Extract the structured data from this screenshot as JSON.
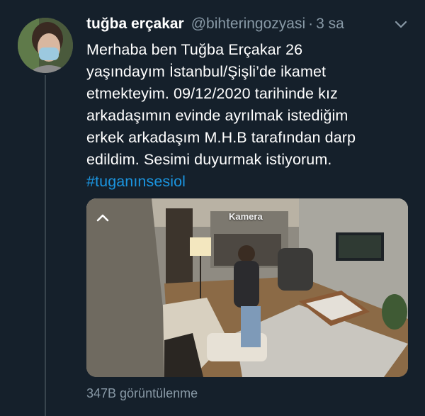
{
  "tweet": {
    "display_name": "tuğba erçakar",
    "handle": "@bihteringozyasi",
    "separator": "·",
    "timestamp": "3 sa",
    "text_lines": [
      "Merhaba ben Tuğba Erçakar 26",
      "yaşındayım İstanbul/Şişli’de ikamet",
      "etmekteyim. 09/12/2020 tarihinde kız",
      "arkadaşımın evinde ayrılmak istediğim",
      "erkek arkadaşım M.H.B tarafından darp",
      "edildim. Sesimi duyurmak istiyorum."
    ],
    "hashtag": "#tuganınsesiol",
    "media_overlay_text": "Kamera",
    "views": "347B görüntülenme"
  },
  "icons": {
    "menu": "chevron-down-icon",
    "media_collapse": "chevron-up-icon"
  },
  "colors": {
    "background": "#15202b",
    "secondary_text": "#8899a6",
    "link": "#1b95e0"
  }
}
